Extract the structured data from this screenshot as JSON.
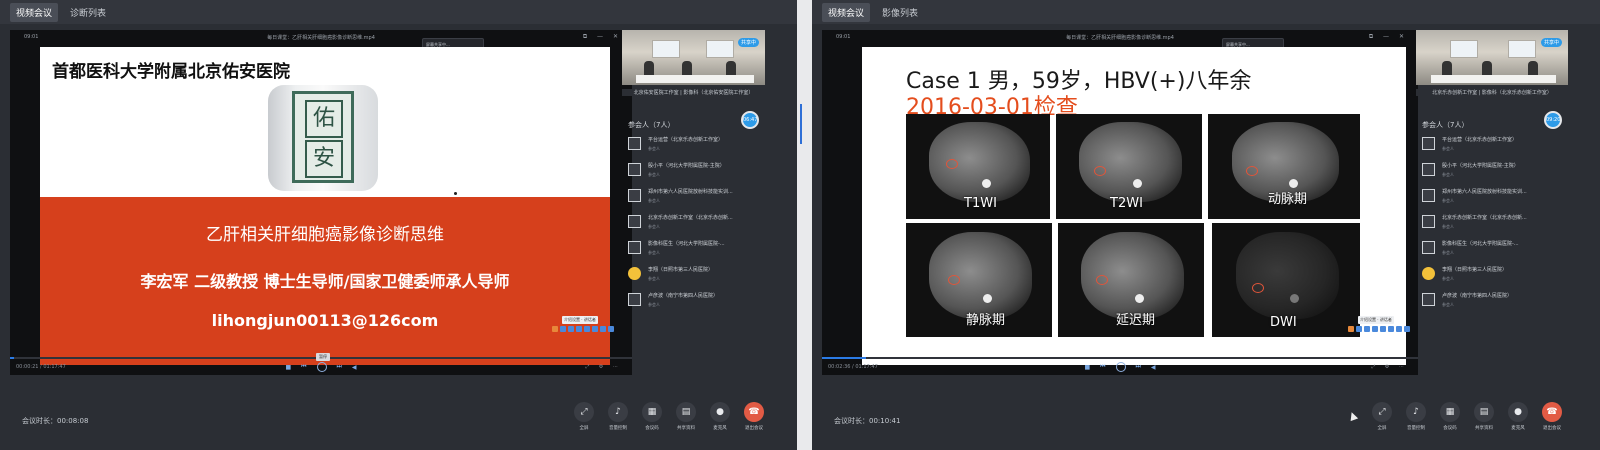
{
  "left": {
    "tabs": [
      "视频会议",
      "诊断列表"
    ],
    "player": {
      "title": "每日课堂：乙肝相关肝细胞癌影像诊断思维.mp4",
      "time_top": "09:01",
      "popup_title": "屏幕共享中...",
      "popup_time": "00:00:25",
      "popup_btn": "停止共享",
      "time_bottom": "00:00:21 / 01:17:47",
      "tooltip": "暂停"
    },
    "slide": {
      "hospital": "首都医科大学附属北京佑安医院",
      "seal_chars": [
        "佑",
        "安"
      ],
      "title": "乙肝相关肝细胞癌影像诊断思维",
      "speaker": "李宏军  二级教授  博士生导师/国家卫健委师承人导师",
      "email": "lihongjun00113@126com"
    },
    "side": {
      "video_badge": "共享中",
      "video_label": "北京佑安医院工作室 | 影像科（北京佑安医院工作室）",
      "time_dot": "06:47",
      "attendees_header": "参会人（7人）",
      "participants": [
        {
          "name": "平台运营（北京乐赤创新工作室）",
          "role": "参会人"
        },
        {
          "name": "殷小平（河北大学附属医院-主院）",
          "role": "参会人"
        },
        {
          "name": "郑州市第六人民医院放射科技能实训...",
          "role": "参会人"
        },
        {
          "name": "北京乐赤创新工作室（北京乐赤创新...",
          "role": "参会人"
        },
        {
          "name": "影像科医生（河北大学附属医院-...",
          "role": "参会人"
        },
        {
          "name": "李翔（日照市第三人民医院）",
          "role": "参会人"
        },
        {
          "name": "卢彦波（南宁市第四人民医院）",
          "role": "参会人"
        }
      ],
      "mini_label": "介绍设置 · 讲话者"
    },
    "bottom": {
      "duration": "会议时长：00:08:08",
      "buttons": [
        "全屏",
        "音量控制",
        "会议码",
        "共享资料",
        "麦克风",
        "退出会议"
      ]
    }
  },
  "right": {
    "tabs": [
      "视频会议",
      "影像列表"
    ],
    "player": {
      "title": "每日课堂：乙肝相关肝细胞癌影像诊断思维.mp4",
      "time_top": "09:01",
      "popup_title": "屏幕共享中...",
      "popup_time": "00:00:25",
      "popup_btn": "停止共享",
      "time_bottom": "00:02:36 / 01:17:47"
    },
    "slide": {
      "case_line": "Case 1 男，59岁，HBV(+)八年余",
      "date_line": "2016-03-01检查",
      "scans": [
        "T1WI",
        "T2WI",
        "动脉期",
        "静脉期",
        "延迟期",
        "DWI"
      ]
    },
    "side": {
      "video_badge": "共享中",
      "video_label": "北京乐赤创新工作室 | 影像科（北京乐赤创新工作室）",
      "time_dot": "09:20",
      "attendees_header": "参会人（7人）",
      "participants": [
        {
          "name": "平台运营（北京乐赤创新工作室）",
          "role": "参会人"
        },
        {
          "name": "殷小平（河北大学附属医院-主院）",
          "role": "参会人"
        },
        {
          "name": "郑州市第六人民医院放射科技能实训...",
          "role": "参会人"
        },
        {
          "name": "北京乐赤创新工作室（北京乐赤创新...",
          "role": "参会人"
        },
        {
          "name": "影像科医生（河北大学附属医院-...",
          "role": "参会人"
        },
        {
          "name": "李翔（日照市第三人民医院）",
          "role": "参会人"
        },
        {
          "name": "卢彦波（南宁市第四人民医院）",
          "role": "参会人"
        }
      ],
      "mini_label": "介绍设置 · 讲话者"
    },
    "bottom": {
      "duration": "会议时长：00:10:41",
      "buttons": [
        "全屏",
        "音量控制",
        "会议码",
        "共享资料",
        "麦克风",
        "退出会议"
      ]
    }
  },
  "colors": {
    "accent": "#2e9be8",
    "hangup": "#e25b45",
    "slide_red": "#d6401c",
    "date_red": "#e44d1d"
  },
  "icons": [
    "fullscreen-icon",
    "volume-icon",
    "qrcode-icon",
    "document-icon",
    "microphone-icon",
    "hangup-icon"
  ]
}
